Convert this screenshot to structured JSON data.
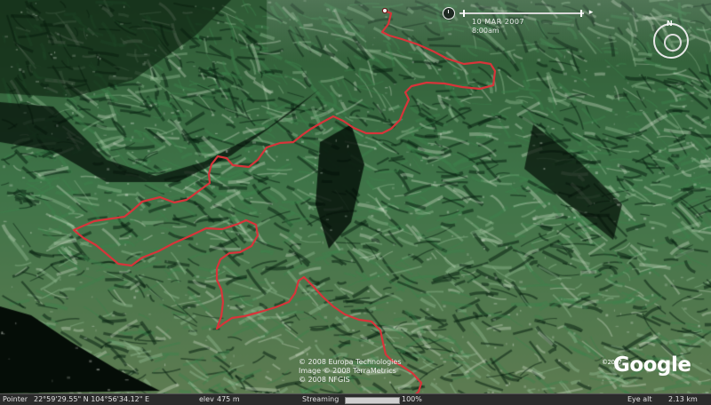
{
  "time_slider": {
    "date": "10 MAR 2007",
    "time": "8:00am"
  },
  "compass": {
    "north_label": "N"
  },
  "imagery_credits": [
    "© 2008 Europa Technologies",
    "Image © 2008 TerraMetrics",
    "© 2008 NFGIS"
  ],
  "logo": {
    "year": "©2007",
    "text": "Google"
  },
  "status_bar": {
    "pointer_label": "Pointer",
    "pointer_coords": "22°59'29.55\" N  104°56'34.12\" E",
    "elevation_label": "elev",
    "elevation_value": "475 m",
    "streaming_label": "Streaming",
    "streaming_percent": "100%",
    "streaming_fraction": 1.0,
    "eye_alt_label": "Eye alt",
    "eye_alt_value": "2.13 km"
  },
  "colors": {
    "track_red": "#d8343a",
    "terrain_dark": "#0f2a17",
    "terrain_mid": "#2f6b3d",
    "terrain_light": "#8fb58a",
    "sky_shadow": "#061008"
  },
  "icons": [
    "clock-icon",
    "play-icon",
    "compass-north-icon"
  ]
}
